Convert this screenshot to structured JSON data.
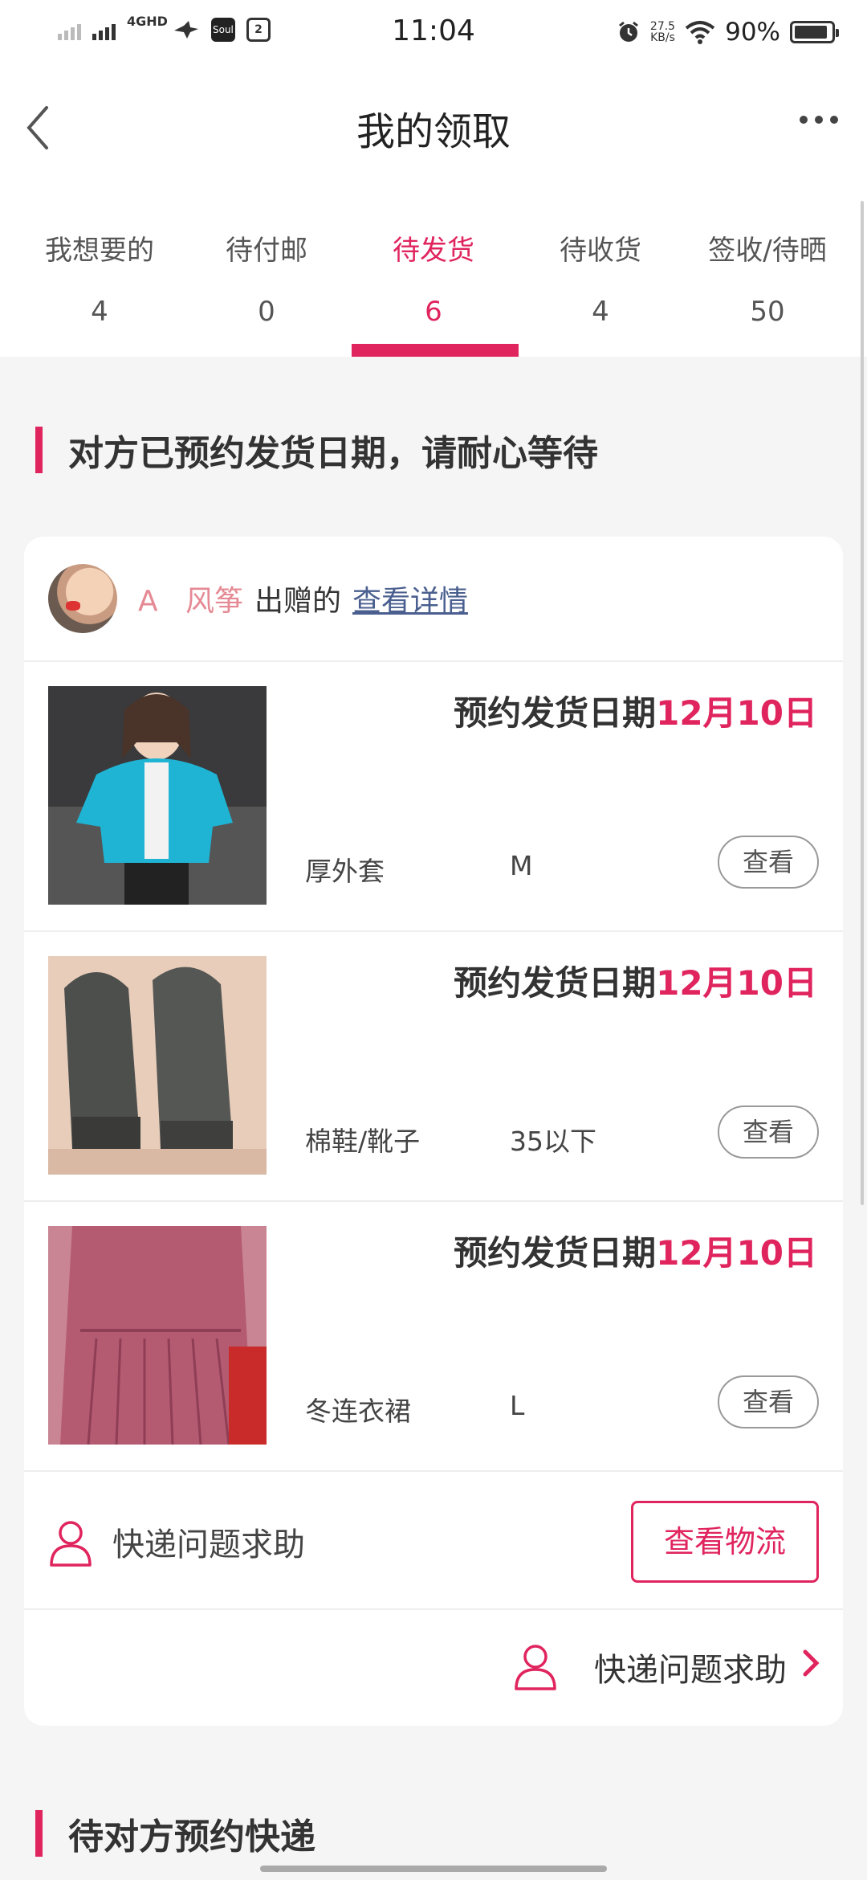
{
  "status_bar": {
    "network": "4GHD",
    "app_icon_1": "Soul",
    "app_icon_2": "2",
    "time": "11:04",
    "speed_value": "27.5",
    "speed_unit": "KB/s",
    "battery": "90%",
    "battery_level": 0.9
  },
  "nav": {
    "title": "我的领取",
    "back_icon": "chevron-left-icon",
    "more_icon": "more-dots-icon"
  },
  "tabs": [
    {
      "label": "我想要的",
      "count": "4"
    },
    {
      "label": "待付邮",
      "count": "0"
    },
    {
      "label": "待发货",
      "count": "6",
      "active": true
    },
    {
      "label": "待收货",
      "count": "4"
    },
    {
      "label": "签收/待晒",
      "count": "50"
    }
  ],
  "section1": {
    "title": "对方已预约发货日期，请耐心等待"
  },
  "card": {
    "donor": {
      "name": "A   风筝",
      "verb": "出赠的",
      "link": "查看详情"
    },
    "items": [
      {
        "date_label": "预约发货日期",
        "date_value": "12月10日",
        "name": "厚外套",
        "size": "M",
        "button": "查看"
      },
      {
        "date_label": "预约发货日期",
        "date_value": "12月10日",
        "name": "棉鞋/靴子",
        "size": "35以下",
        "button": "查看"
      },
      {
        "date_label": "预约发货日期",
        "date_value": "12月10日",
        "name": "冬连衣裙",
        "size": "L",
        "button": "查看"
      }
    ],
    "help_text": "快递问题求助",
    "logistics_button": "查看物流",
    "help_text_2": "快递问题求助"
  },
  "section2": {
    "title": "待对方预约快递"
  },
  "colors": {
    "accent": "#e0245e",
    "link": "#4a5f8f",
    "nick": "#e58a94"
  }
}
